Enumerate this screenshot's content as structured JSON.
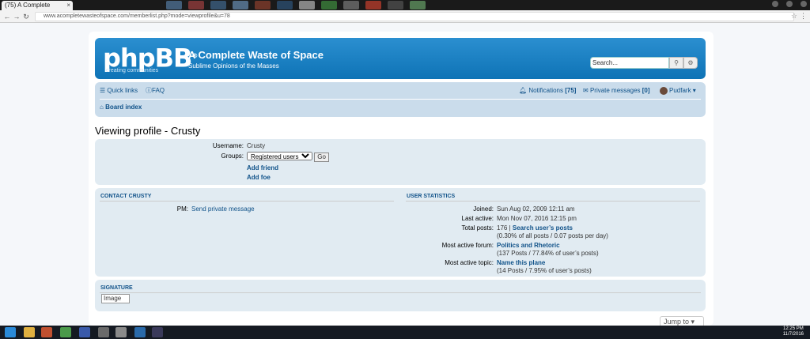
{
  "browser": {
    "tab_title": "(75) A Complete",
    "tab_close": "×",
    "url": "www.acompletewasteofspace.com/memberlist.php?mode=viewprofile&u=78"
  },
  "site": {
    "logo_text": "phpBB",
    "logo_reg": "®",
    "logo_tagline": "creating communities",
    "title": "A Complete Waste of Space",
    "description": "Sublime Opinions of the Masses",
    "search_placeholder": "Search..."
  },
  "navbar": {
    "quick_links": "Quick links",
    "faq": "FAQ",
    "notifications_label": "Notifications",
    "notifications_count": "[75]",
    "pm_label": "Private messages",
    "pm_count": "[0]",
    "username": "Pudfark",
    "board_index": "Board index"
  },
  "profile": {
    "heading": "Viewing profile - Crusty",
    "username_label": "Username:",
    "username_value": "Crusty",
    "groups_label": "Groups:",
    "groups_selected": "Registered users",
    "go_button": "Go",
    "add_friend": "Add friend",
    "add_foe": "Add foe"
  },
  "contact": {
    "title": "CONTACT CRUSTY",
    "pm_label": "PM:",
    "pm_link": "Send private message"
  },
  "stats": {
    "title": "USER STATISTICS",
    "joined_label": "Joined:",
    "joined_value": "Sun Aug 02, 2009 12:11 am",
    "last_active_label": "Last active:",
    "last_active_value": "Mon Nov 07, 2016 12:15 pm",
    "total_posts_label": "Total posts:",
    "total_posts_value": "176 |",
    "search_posts_link": "Search user’s posts",
    "total_posts_detail": "(0.30% of all posts / 0.07 posts per day)",
    "active_forum_label": "Most active forum:",
    "active_forum_value": "Politics and Rhetoric",
    "active_forum_detail": "(137 Posts / 77.84% of user’s posts)",
    "active_topic_label": "Most active topic:",
    "active_topic_value": "Name this plane",
    "active_topic_detail": "(14 Posts / 7.95% of user’s posts)"
  },
  "signature": {
    "title": "SIGNATURE",
    "image_alt": "Image"
  },
  "footer": {
    "jump_to": "Jump to"
  },
  "taskbar": {
    "time": "12:25 PM",
    "date": "11/7/2016"
  },
  "colors": {
    "header_blue": "#0e73b6",
    "link_blue": "#105289",
    "panel_bg": "#e1ebf2",
    "navbar_bg": "#cadceb"
  }
}
